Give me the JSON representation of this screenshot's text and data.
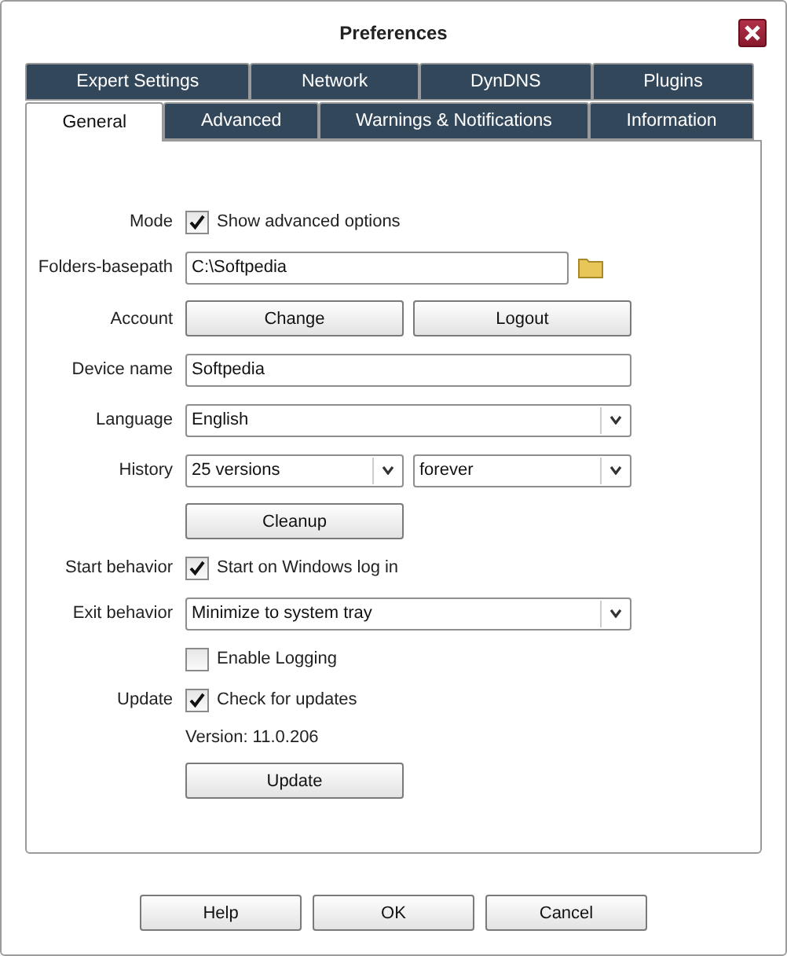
{
  "window": {
    "title": "Preferences"
  },
  "tab_rows": [
    [
      {
        "label": "Expert Settings",
        "selected": false
      },
      {
        "label": "Network",
        "selected": false
      },
      {
        "label": "DynDNS",
        "selected": false
      },
      {
        "label": "Plugins",
        "selected": false
      }
    ],
    [
      {
        "label": "General",
        "selected": true
      },
      {
        "label": "Advanced",
        "selected": false
      },
      {
        "label": "Warnings & Notifications",
        "selected": false
      },
      {
        "label": "Information",
        "selected": false
      }
    ]
  ],
  "rows": [
    {
      "kind": "checkbox",
      "label": "Mode",
      "text": "Show advanced options",
      "checked": true
    },
    {
      "kind": "folder",
      "label": "Folders-basepath",
      "value": "C:\\Softpedia"
    },
    {
      "kind": "buttons",
      "label": "Account",
      "buttons": [
        "Change",
        "Logout"
      ]
    },
    {
      "kind": "text",
      "label": "Device name",
      "value": "Softpedia"
    },
    {
      "kind": "select",
      "label": "Language",
      "value": "English"
    },
    {
      "kind": "selects",
      "label": "History",
      "values": [
        "25 versions",
        "forever"
      ]
    },
    {
      "kind": "buttons",
      "buttons": [
        "Cleanup"
      ]
    },
    {
      "kind": "checkbox",
      "label": "Start behavior",
      "text": "Start on Windows log in",
      "checked": true
    },
    {
      "kind": "select",
      "label": "Exit behavior",
      "value": "Minimize to system tray"
    },
    {
      "kind": "checkbox",
      "text": "Enable Logging",
      "checked": false
    },
    {
      "kind": "checkbox",
      "label": "Update",
      "text": "Check for updates",
      "checked": true
    },
    {
      "kind": "note",
      "text": "Version: 11.0.206"
    },
    {
      "kind": "buttons",
      "buttons": [
        "Update"
      ]
    }
  ],
  "buttons": [
    "Help",
    "OK",
    "Cancel"
  ]
}
